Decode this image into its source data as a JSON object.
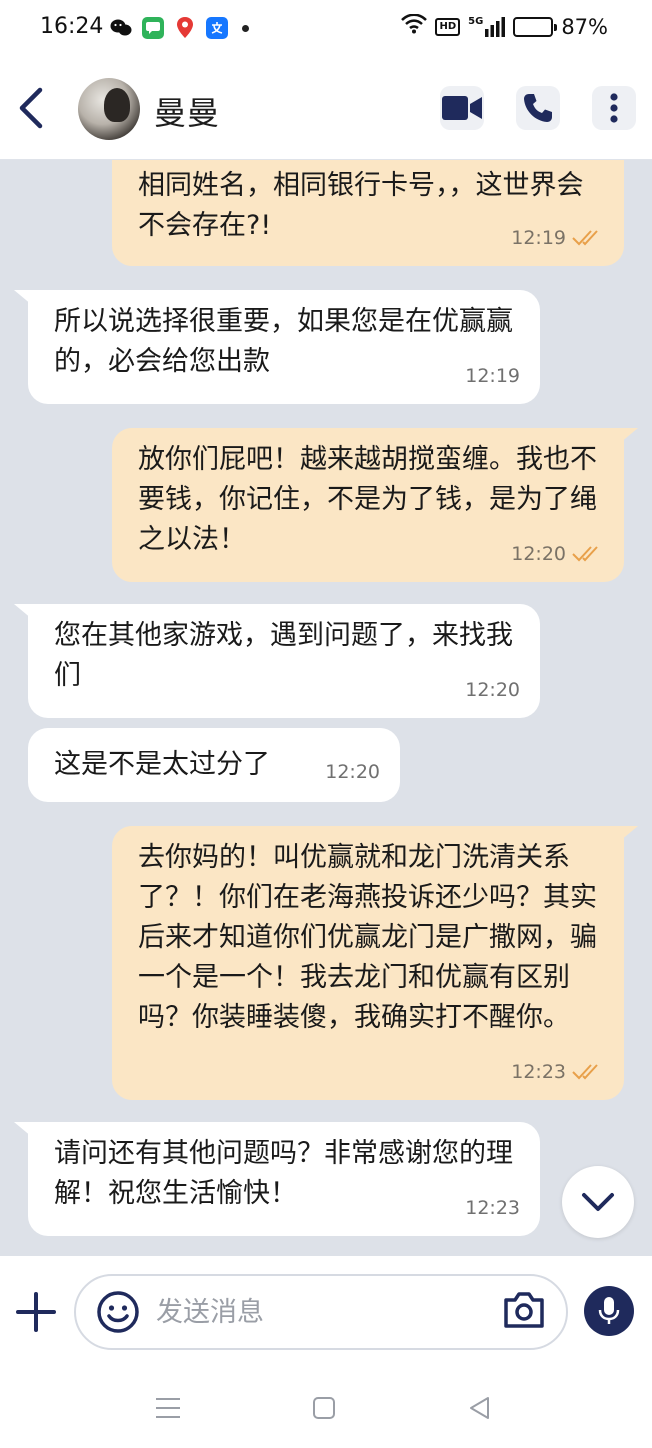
{
  "status_bar": {
    "time": "16:24",
    "battery": "87%",
    "battery_level": 0.87,
    "network": "5G",
    "hd": "HD",
    "apps": [
      "wechat-icon",
      "messages-icon",
      "maps-icon",
      "alipay-icon"
    ]
  },
  "header": {
    "contact_name": "曼曼",
    "icons": [
      "back-icon",
      "video-call-icon",
      "phone-icon",
      "more-icon"
    ]
  },
  "messages": [
    {
      "dir": "out",
      "text": "相同姓名，相同银行卡号，，这世界会不会存在?!",
      "time": "12:19",
      "read": true
    },
    {
      "dir": "in",
      "text": "所以说选择很重要，如果您是在优赢赢的，必会给您出款",
      "time": "12:19"
    },
    {
      "dir": "out",
      "text": "放你们屁吧！越来越胡搅蛮缠。我也不要钱，你记住，不是为了钱，是为了绳之以法！",
      "time": "12:20",
      "read": true
    },
    {
      "dir": "in",
      "text": "您在其他家游戏，遇到问题了，来找我们",
      "time": "12:20"
    },
    {
      "dir": "in",
      "text": "这是不是太过分了",
      "time": "12:20"
    },
    {
      "dir": "out",
      "text": "去你妈的！叫优赢就和龙门洗清关系了？！你们在老海燕投诉还少吗？其实后来才知道你们优赢龙门是广撒网，骗一个是一个！我去龙门和优赢有区别吗？你装睡装傻，我确实打不醒你。",
      "time": "12:23",
      "read": true
    },
    {
      "dir": "in",
      "text": "请问还有其他问题吗？非常感谢您的理解！祝您生活愉快！",
      "time": "12:23"
    }
  ],
  "input": {
    "placeholder": "发送消息",
    "value": ""
  },
  "colors": {
    "outgoing_bubble": "#fbe6c5",
    "incoming_bubble": "#ffffff",
    "chat_background": "#dde1e8",
    "accent": "#1f2a5c",
    "read_check": "#e8a04a"
  }
}
